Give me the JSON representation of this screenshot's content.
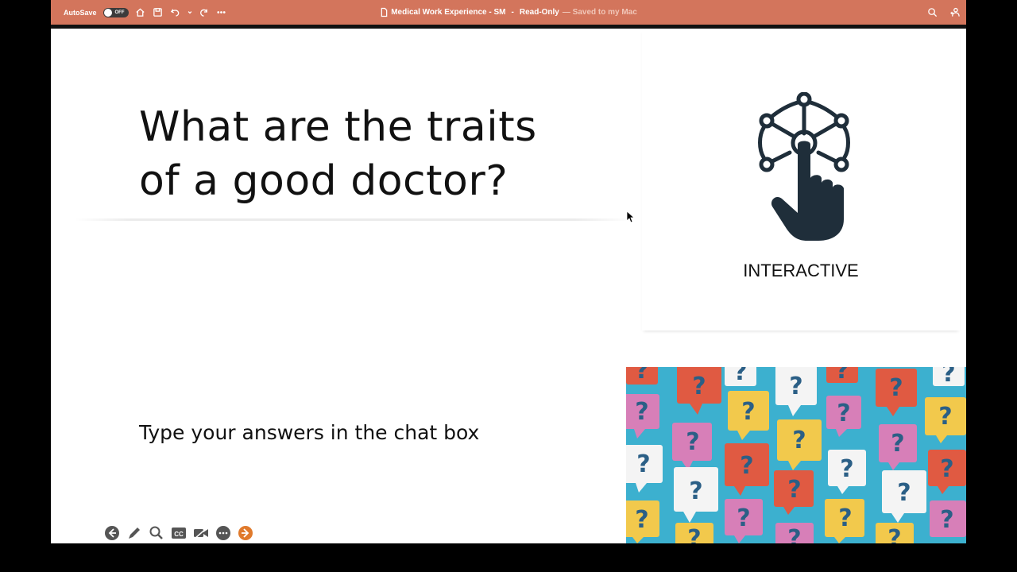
{
  "titlebar": {
    "autosave_label": "AutoSave",
    "autosave_state": "OFF",
    "doc_title": "Medical Work Experience - SM",
    "separator": "-",
    "mode": "Read-Only",
    "save_status": "— Saved to my Mac",
    "bg_color": "#d3755c"
  },
  "slide": {
    "title_line1": "What are the traits",
    "title_line2": "of a good doctor?",
    "body": "Type your answers in the chat box",
    "interactive_label": "INTERACTIVE",
    "icon_color": "#1f2e3a"
  },
  "questions_image": {
    "bubble_mark": "?",
    "bubble_colors": [
      "#e05a42",
      "#f2c94c",
      "#d77fb8",
      "#f4f4f4"
    ],
    "bg_color": "#3cb0cf"
  },
  "slideshow_controls": {
    "icons": [
      "back-arrow-icon",
      "pen-icon",
      "zoom-icon",
      "closed-captions-icon",
      "camera-icon",
      "more-icon",
      "next-arrow-icon"
    ],
    "cc_label": "CC",
    "accent": "#e07a2c"
  }
}
